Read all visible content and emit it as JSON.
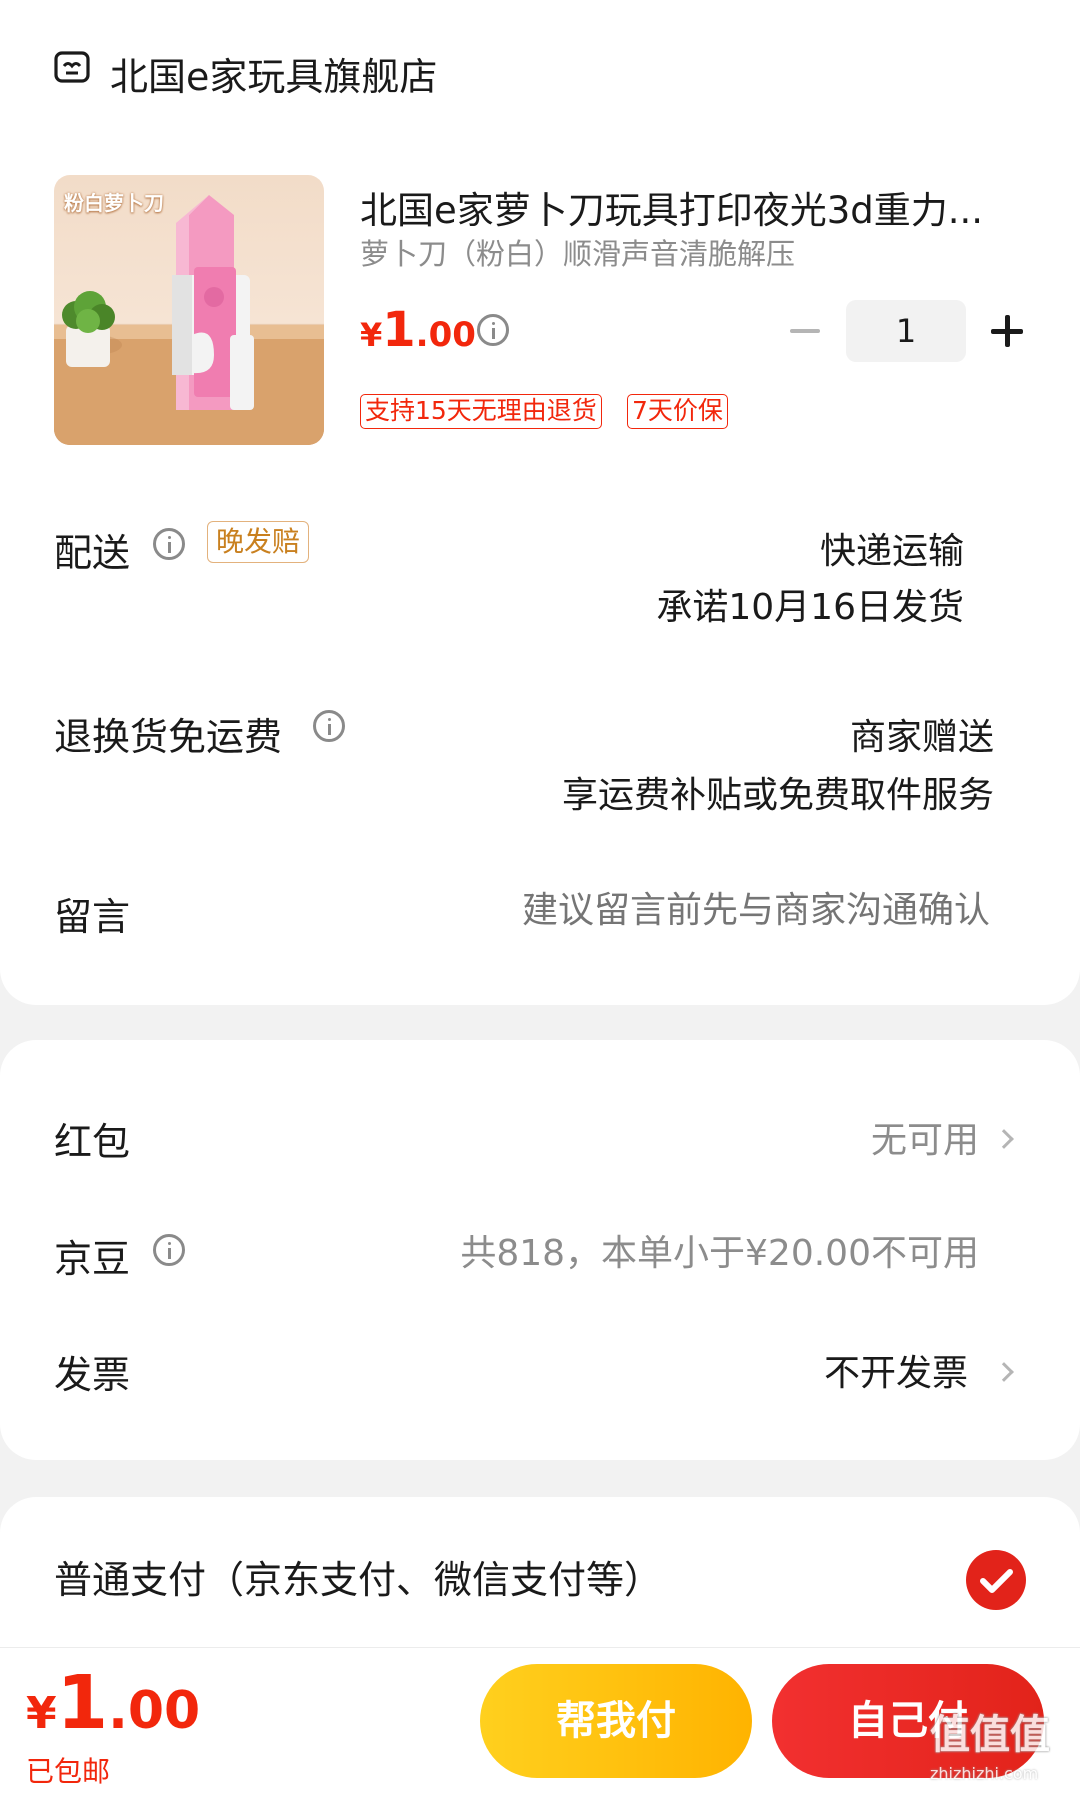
{
  "store": {
    "name": "北国e家玩具旗舰店",
    "icon": "store-icon"
  },
  "product": {
    "image_caption": "粉白萝卜刀",
    "title": "北国e家萝卜刀玩具打印夜光3d重力...",
    "variant": "萝卜刀（粉白）顺滑声音清脆解压",
    "price_symbol": "¥",
    "price_int": "1",
    "price_dec": ".00",
    "quantity": "1",
    "tags": [
      "支持15天无理由退货",
      "7天价保"
    ]
  },
  "delivery": {
    "label": "配送",
    "badge": "晚发赔",
    "method": "快递运输",
    "promise": "承诺10月16日发货"
  },
  "returns": {
    "label": "退换货免运费",
    "value": "商家赠送",
    "desc": "享运费补贴或免费取件服务"
  },
  "message": {
    "label": "留言",
    "placeholder": "建议留言前先与商家沟通确认"
  },
  "red_packet": {
    "label": "红包",
    "value": "无可用"
  },
  "jd_beans": {
    "label": "京豆",
    "value": "共818，本单小于¥20.00不可用"
  },
  "invoice": {
    "label": "发票",
    "value": "不开发票"
  },
  "payment": {
    "label": "普通支付（京东支付、微信支付等）",
    "selected": true
  },
  "footer": {
    "total_symbol": "¥",
    "total_int": "1",
    "total_dec": ".00",
    "shipping_note": "已包邮",
    "help_pay_label": "帮我付",
    "self_pay_label": "自己付"
  },
  "watermark": {
    "text": "值值值",
    "sub": "zhizhizhi.com"
  },
  "colors": {
    "accent_red": "#e2231a",
    "price_red": "#f2270c",
    "gold": "#f5b800",
    "badge_gold": "#c9801f"
  }
}
